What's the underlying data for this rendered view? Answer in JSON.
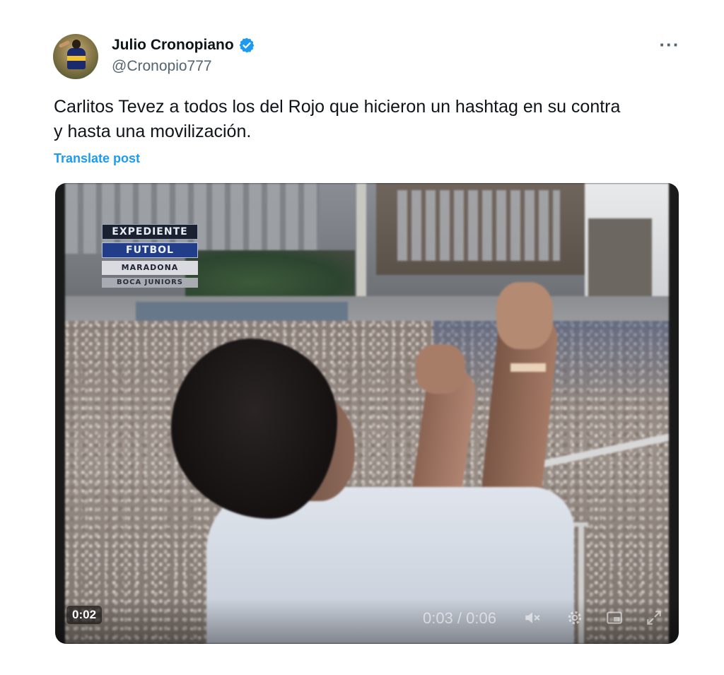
{
  "author": {
    "display_name": "Julio Cronopiano",
    "handle": "@Cronopio777",
    "verified_icon": "verified-badge-icon",
    "avatar_icon": "avatar-photo"
  },
  "more_label": "···",
  "post": {
    "text_line1": "Carlitos Tevez a todos los del Rojo que hicieron un hashtag en su contra",
    "text_line2": "y hasta una movilización.",
    "translate_label": "Translate post"
  },
  "video": {
    "overlay_logo": {
      "line1": "EXPEDIENTE",
      "line2": "FUTBOL",
      "line3": "MARADONA",
      "line4": "BOCA JUNIORS"
    },
    "elapsed": "0:02",
    "time_display": "0:03 / 0:06",
    "icons": [
      "volume-muted-icon",
      "settings-gear-icon",
      "picture-in-picture-icon",
      "fullscreen-icon"
    ]
  },
  "colors": {
    "accent": "#1d9bf0",
    "text": "#0f1419",
    "secondary_text": "#536471"
  }
}
